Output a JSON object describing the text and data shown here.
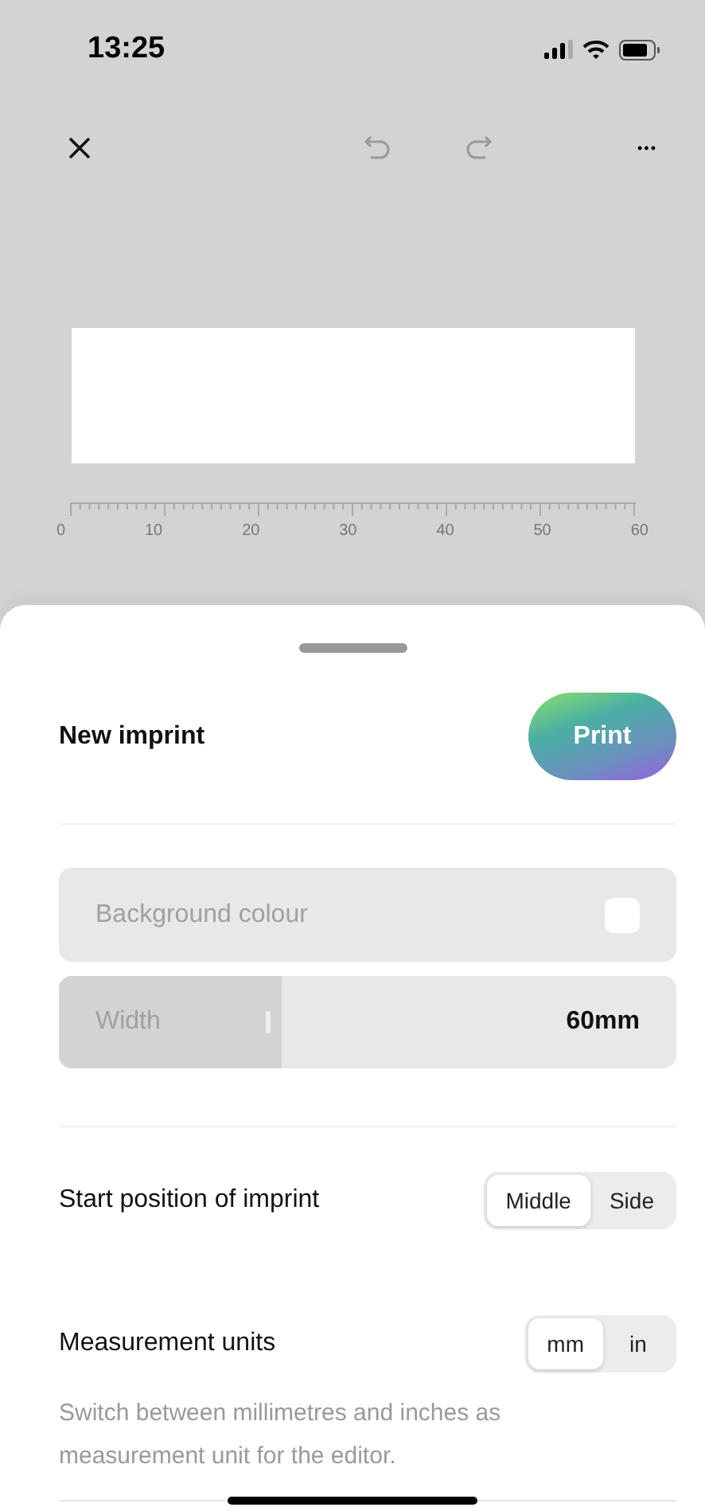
{
  "status_bar": {
    "time": "13:25"
  },
  "toolbar": {
    "more": "•••"
  },
  "ruler": {
    "labels": [
      "0",
      "10",
      "20",
      "30",
      "40",
      "50",
      "60"
    ]
  },
  "sheet": {
    "title": "New imprint",
    "print_button": "Print",
    "background_colour": {
      "label": "Background colour"
    },
    "width": {
      "label": "Width",
      "value": "60mm",
      "level": 0.36
    },
    "settings": [
      {
        "label": "Start position of imprint",
        "options": [
          {
            "label": "Middle",
            "selected": true
          },
          {
            "label": "Side",
            "selected": false
          }
        ]
      },
      {
        "label": "Measurement units",
        "options": [
          {
            "label": "mm",
            "selected": true
          },
          {
            "label": "in",
            "selected": false
          }
        ],
        "description": "Switch between millimetres and inches as measurement unit for the editor."
      }
    ]
  }
}
